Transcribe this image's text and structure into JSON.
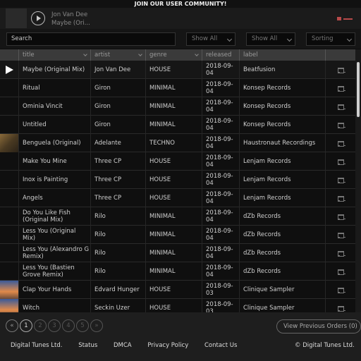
{
  "banner": "JOIN OUR USER COMMUNITY!",
  "now_playing": {
    "artist": "Jon Van Dee",
    "title": "Maybe (Ori..."
  },
  "search": {
    "placeholder": "Search"
  },
  "filters": {
    "filter1": "Show All",
    "filter2": "Show All",
    "sorting": "Sorting"
  },
  "columns": {
    "title": "title",
    "artist": "artist",
    "genre": "genre",
    "released": "released",
    "label": "label"
  },
  "tracks": [
    {
      "title": "Maybe (Original Mix)",
      "artist": "Jon Van Dee",
      "genre": "HOUSE",
      "released": "2018-09-04",
      "label": "Beatfusion"
    },
    {
      "title": "Ritual",
      "artist": "Giron",
      "genre": "MINIMAL",
      "released": "2018-09-04",
      "label": "Konsep Records"
    },
    {
      "title": "Ominia Vincit",
      "artist": "Giron",
      "genre": "MINIMAL",
      "released": "2018-09-04",
      "label": "Konsep Records"
    },
    {
      "title": "Untitled",
      "artist": "Giron",
      "genre": "MINIMAL",
      "released": "2018-09-04",
      "label": "Konsep Records"
    },
    {
      "title": "Benguela (Original)",
      "artist": "Adelante",
      "genre": "TECHNO",
      "released": "2018-09-04",
      "label": "Haustronaut Recordings"
    },
    {
      "title": "Make You Mine",
      "artist": "Three CP",
      "genre": "HOUSE",
      "released": "2018-09-04",
      "label": "Lenjam Records"
    },
    {
      "title": "Inox is Painting",
      "artist": "Three CP",
      "genre": "HOUSE",
      "released": "2018-09-04",
      "label": "Lenjam Records"
    },
    {
      "title": "Angels",
      "artist": "Three CP",
      "genre": "HOUSE",
      "released": "2018-09-04",
      "label": "Lenjam Records"
    },
    {
      "title": "Do You Like Fish (Original Mix)",
      "artist": "Rilo",
      "genre": "MINIMAL",
      "released": "2018-09-04",
      "label": "dZb Records"
    },
    {
      "title": "Less You (Original Mix)",
      "artist": "Rilo",
      "genre": "MINIMAL",
      "released": "2018-09-04",
      "label": "dZb Records"
    },
    {
      "title": "Less You (Alexandro G Remix)",
      "artist": "Rilo",
      "genre": "MINIMAL",
      "released": "2018-09-04",
      "label": "dZb Records"
    },
    {
      "title": "Less You (Bastien Grove Remix)",
      "artist": "Rilo",
      "genre": "MINIMAL",
      "released": "2018-09-04",
      "label": "dZb Records"
    },
    {
      "title": "Clap Your Hands",
      "artist": "Edvard Hunger",
      "genre": "HOUSE",
      "released": "2018-09-03",
      "label": "Clinique Sampler"
    },
    {
      "title": "Witch",
      "artist": "Seckin Uzer",
      "genre": "HOUSE",
      "released": "2018-09-03",
      "label": "Clinique Sampler"
    }
  ],
  "pagination": {
    "prev": "«",
    "next": "»",
    "pages": [
      "1",
      "2",
      "3",
      "4",
      "5"
    ],
    "current": "1"
  },
  "prev_orders": "View Previous Orders (0)",
  "footer": {
    "links": [
      "Digital Tunes Ltd.",
      "Status",
      "DMCA",
      "Privacy Policy",
      "Contact Us"
    ],
    "copyright": "© Digital Tunes Ltd."
  },
  "colors": {
    "accent": "#b84a4a",
    "background": "#0d0d0d",
    "header": "#3a3a3a"
  },
  "icons": {
    "play": "play-icon",
    "cart": "cart-icon",
    "volume": "volume-icon"
  }
}
